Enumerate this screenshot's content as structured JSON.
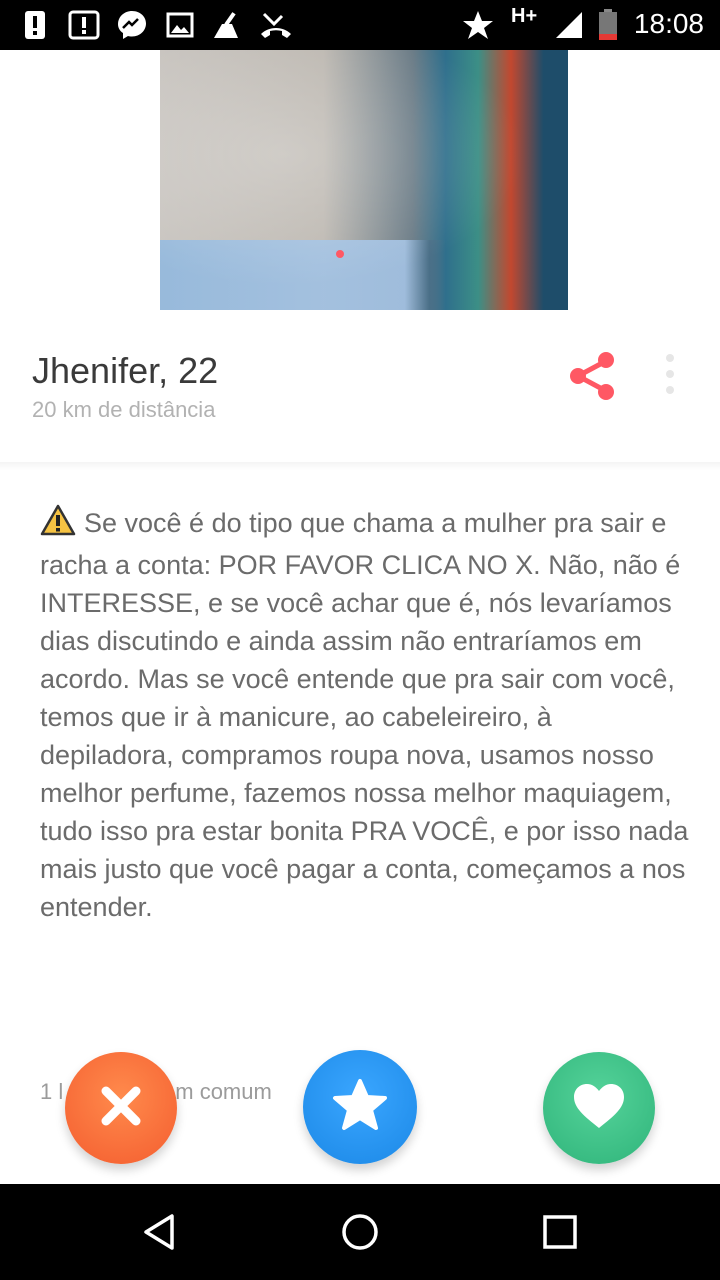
{
  "status_bar": {
    "time": "18:08",
    "network": "H+",
    "icons": [
      "alert-icon",
      "notification-icon",
      "messenger-icon",
      "image-icon",
      "cleaner-icon",
      "missed-call-icon",
      "star-icon",
      "signal-icon",
      "battery-icon"
    ]
  },
  "profile": {
    "name_age": "Jhenifer, 22",
    "distance": "20 km de distância"
  },
  "bio": {
    "text": "Se você é do tipo que chama a mulher pra sair e racha a conta: POR FAVOR CLICA NO X. Não, não é INTERESSE, e se você achar que é, nós levaríamos dias discutindo e ainda assim não entraríamos em acordo. Mas se você entende que pra sair com você, temos que ir à manicure, ao cabeleireiro, à depiladora, compramos roupa nova, usamos nosso melhor perfume, fazemos nossa melhor maquiagem, tudo isso pra estar bonita PRA VOCÊ, e por isso nada mais justo que você pagar a conta, começamos a nos entender."
  },
  "common": {
    "text_left": "1 l",
    "text_right": "m comum"
  },
  "actions": {
    "nope": "nope-icon",
    "superlike": "superlike-star-icon",
    "like": "like-heart-icon"
  },
  "colors": {
    "accent": "#ff5864",
    "nope": "#f45d2f",
    "superlike": "#1b88e6",
    "like": "#2fb47a"
  }
}
